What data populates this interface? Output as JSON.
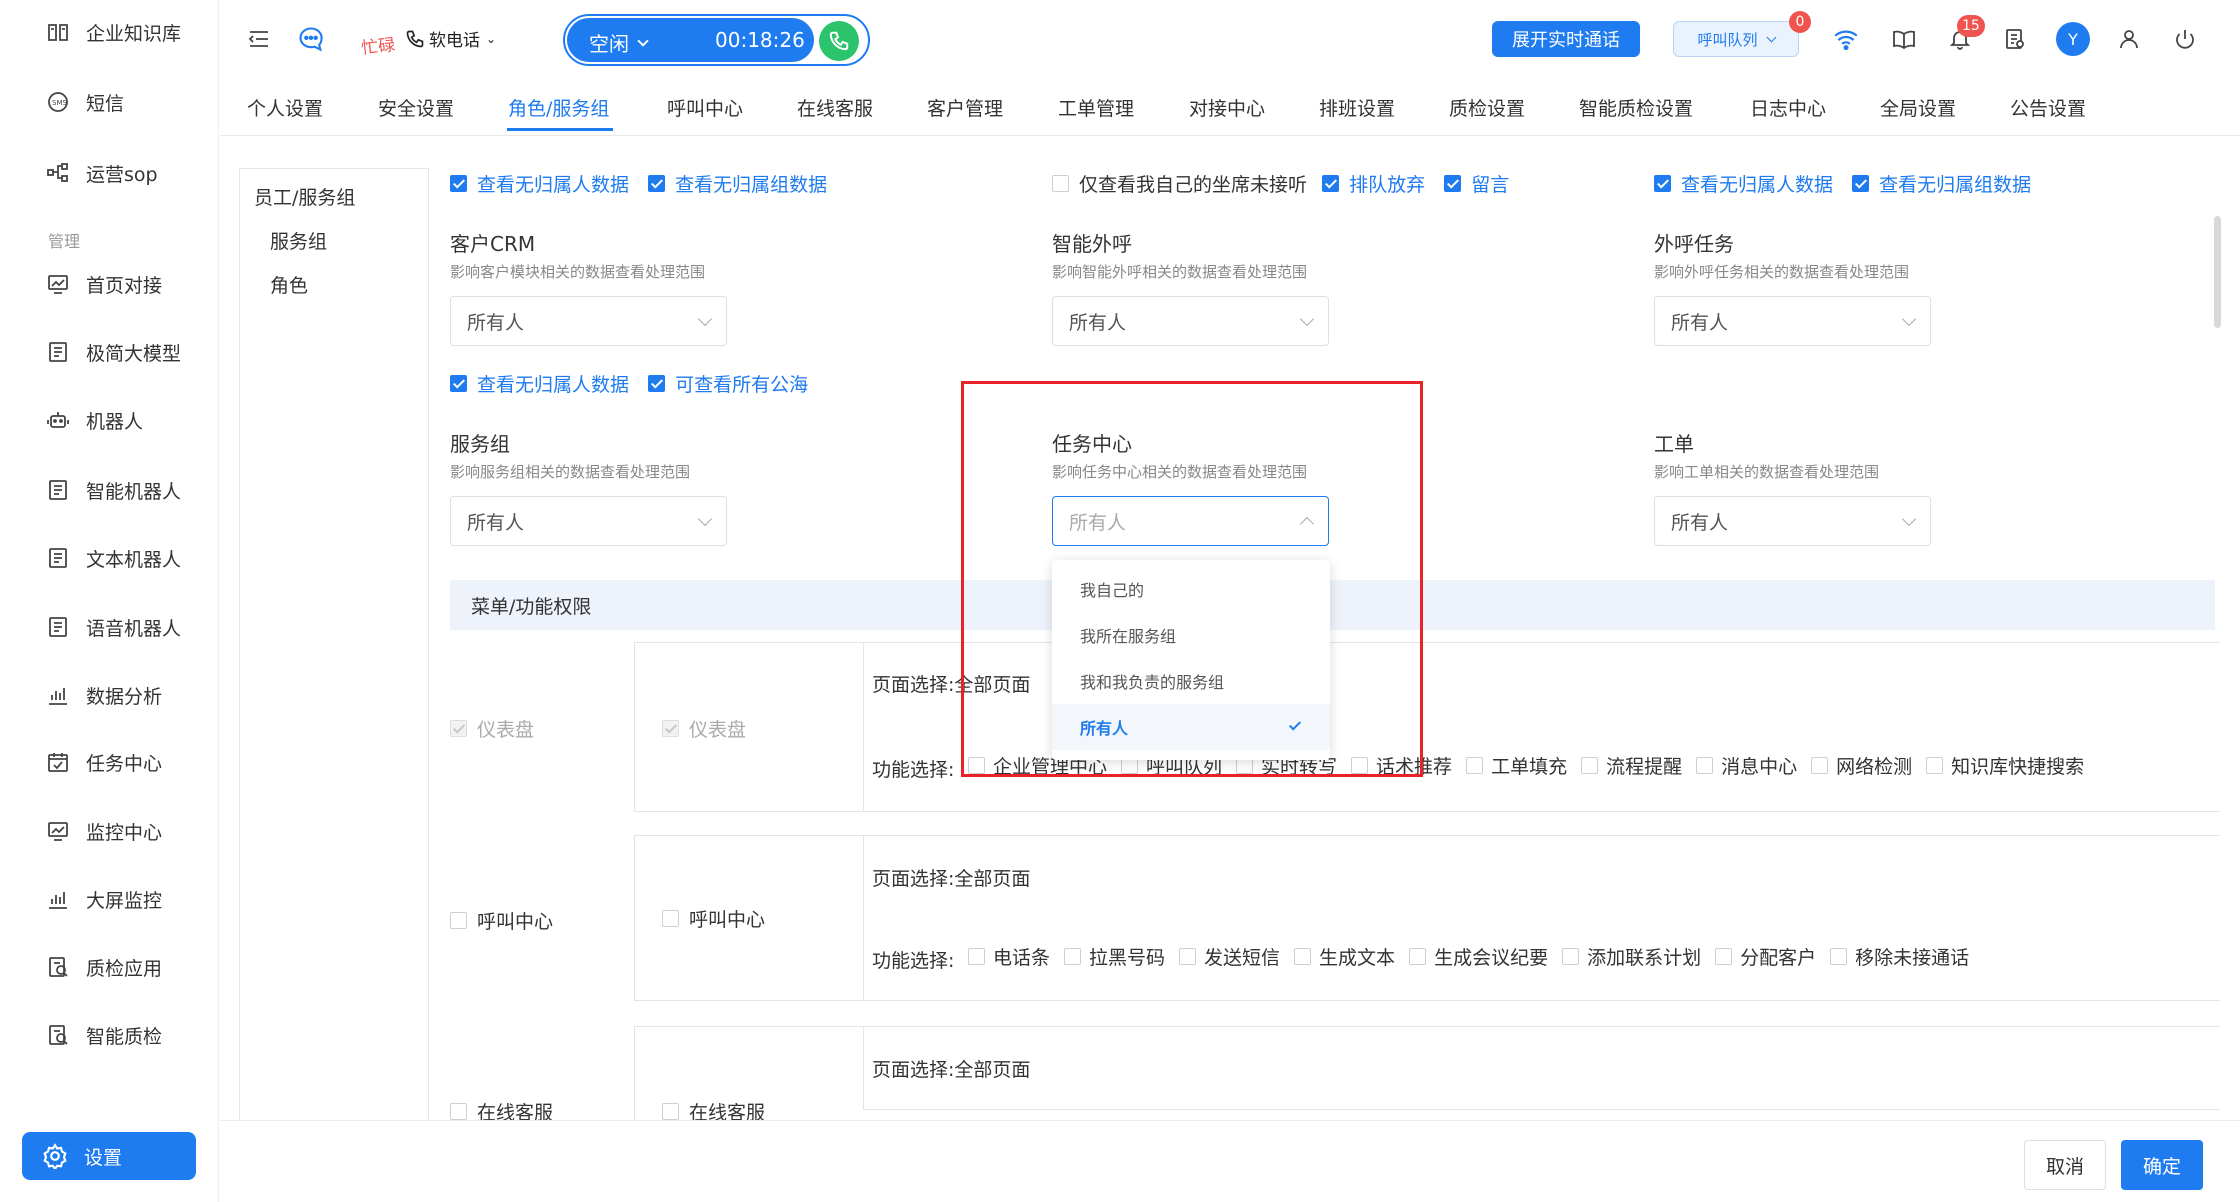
{
  "sidebar": {
    "items": [
      {
        "label": "企业知识库",
        "icon": "book-icon"
      },
      {
        "label": "短信",
        "icon": "sms-icon"
      },
      {
        "label": "运营sop",
        "icon": "flow-icon"
      }
    ],
    "section_label": "管理",
    "manage_items": [
      {
        "label": "首页对接",
        "icon": "chart-screen-icon"
      },
      {
        "label": "极简大模型",
        "icon": "doc-icon"
      },
      {
        "label": "机器人",
        "icon": "robot-icon"
      },
      {
        "label": "智能机器人",
        "icon": "doc-icon"
      },
      {
        "label": "文本机器人",
        "icon": "doc-icon"
      },
      {
        "label": "语音机器人",
        "icon": "doc-icon"
      },
      {
        "label": "数据分析",
        "icon": "bar-chart-icon"
      },
      {
        "label": "任务中心",
        "icon": "calendar-check-icon"
      },
      {
        "label": "监控中心",
        "icon": "chart-screen-icon"
      },
      {
        "label": "大屏监控",
        "icon": "bar-chart-icon"
      },
      {
        "label": "质检应用",
        "icon": "inspect-icon"
      },
      {
        "label": "智能质检",
        "icon": "inspect-icon"
      }
    ],
    "active": {
      "label": "设置",
      "icon": "gear-icon"
    }
  },
  "topbar": {
    "busy_label": "忙碌",
    "softphone_label": "软电话",
    "status_label": "空闲",
    "timer": "00:18:26",
    "expand_button": "展开实时通话",
    "queue_label": "呼叫队列",
    "queue_badge": "0",
    "bell_badge": "15",
    "avatar_letter": "Y",
    "accent": "#1e7bf0"
  },
  "tabs": [
    "个人设置",
    "安全设置",
    "角色/服务组",
    "呼叫中心",
    "在线客服",
    "客户管理",
    "工单管理",
    "对接中心",
    "排班设置",
    "质检设置",
    "智能质检设置",
    "日志中心",
    "全局设置",
    "公告设置"
  ],
  "active_tab": "角色/服务组",
  "tree": {
    "root": "员工/服务组",
    "children": [
      "服务组",
      "角色"
    ]
  },
  "row1": {
    "col1": [
      {
        "label": "查看无归属人数据",
        "checked": true
      },
      {
        "label": "查看无归属组数据",
        "checked": true
      }
    ],
    "col2": [
      {
        "label": "仅查看我自己的坐席未接听",
        "checked": false
      },
      {
        "label": "排队放弃",
        "checked": true
      },
      {
        "label": "留言",
        "checked": true
      }
    ],
    "col3": [
      {
        "label": "查看无归属人数据",
        "checked": true
      },
      {
        "label": "查看无归属组数据",
        "checked": true
      }
    ]
  },
  "scopes": [
    {
      "title": "客户CRM",
      "desc": "影响客户模块相关的数据查看处理范围",
      "value": "所有人"
    },
    {
      "title": "智能外呼",
      "desc": "影响智能外呼相关的数据查看处理范围",
      "value": "所有人"
    },
    {
      "title": "外呼任务",
      "desc": "影响外呼任务相关的数据查看处理范围",
      "value": "所有人"
    },
    {
      "title": "服务组",
      "desc": "影响服务组相关的数据查看处理范围",
      "value": "所有人"
    },
    {
      "title": "任务中心",
      "desc": "影响任务中心相关的数据查看处理范围",
      "value": "所有人"
    },
    {
      "title": "工单",
      "desc": "影响工单相关的数据查看处理范围",
      "value": "所有人"
    }
  ],
  "row2": [
    {
      "label": "查看无归属人数据",
      "checked": true
    },
    {
      "label": "可查看所有公海",
      "checked": true
    }
  ],
  "dropdown": {
    "options": [
      "我自己的",
      "我所在服务组",
      "我和我负责的服务组",
      "所有人"
    ],
    "selected": "所有人"
  },
  "menu": {
    "title": "菜单/功能权限",
    "page_select_label": "页面选择:",
    "func_select_label": "功能选择:",
    "all_pages": "全部页面",
    "groups": [
      {
        "name": "仪表盘",
        "sub": "仪表盘",
        "funcs": [
          "企业管理中心",
          "呼叫队列",
          "实时转写",
          "话术推荐",
          "工单填充",
          "流程提醒",
          "消息中心",
          "网络检测",
          "知识库快捷搜索"
        ]
      },
      {
        "name": "呼叫中心",
        "sub": "呼叫中心",
        "funcs": [
          "电话条",
          "拉黑号码",
          "发送短信",
          "生成文本",
          "生成会议纪要",
          "添加联系计划",
          "分配客户",
          "移除未接通话"
        ]
      },
      {
        "name": "在线客服",
        "sub": "在线客服",
        "funcs": []
      }
    ]
  },
  "footer": {
    "cancel": "取消",
    "ok": "确定"
  }
}
